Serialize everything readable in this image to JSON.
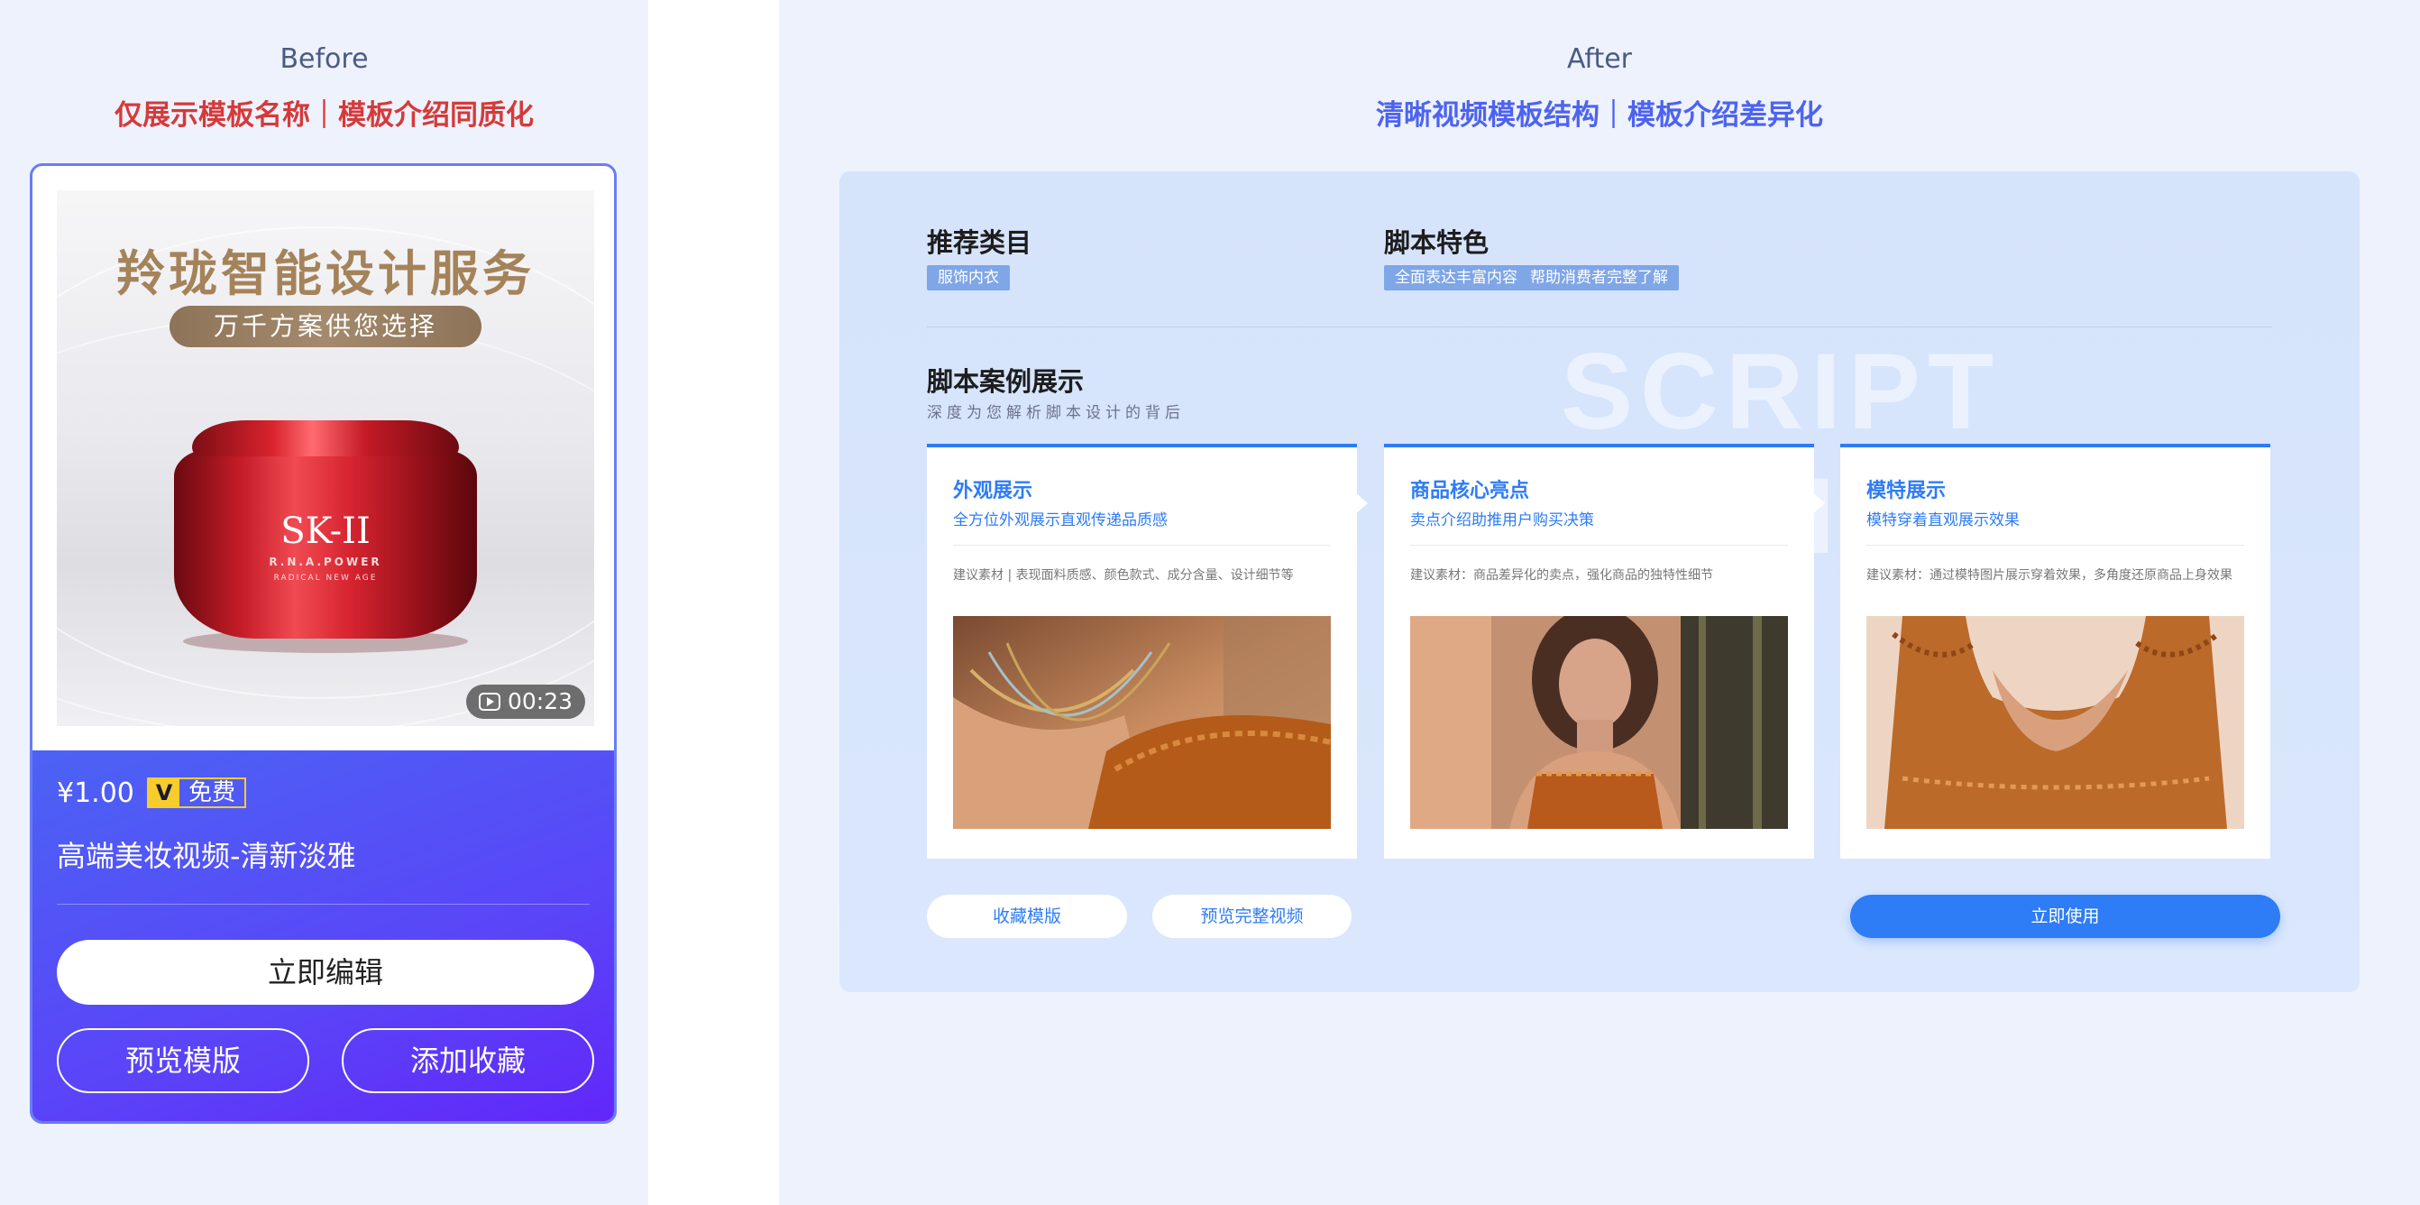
{
  "before": {
    "title": "Before",
    "subtitle": "仅展示模板名称｜模板介绍同质化",
    "card": {
      "thumbnail": {
        "heading": "羚珑智能设计服务",
        "pill": "万千方案供您选择",
        "product_brand": "SK-II",
        "product_line": "R.N.A.POWER",
        "product_sub": "RADICAL NEW AGE",
        "duration": "00:23"
      },
      "price": "¥1.00",
      "vip_letter": "V",
      "vip_label": "免费",
      "template_name": "高端美妆视频-清新淡雅",
      "edit_button": "立即编辑",
      "preview_button": "预览模版",
      "favorite_button": "添加收藏"
    }
  },
  "after": {
    "title": "After",
    "subtitle": "清晰视频模板结构｜模板介绍差异化",
    "recommended": {
      "title": "推荐类目",
      "tags": [
        "服饰内衣"
      ]
    },
    "features": {
      "title": "脚本特色",
      "tags": [
        "全面表达丰富内容",
        "帮助消费者完整了解"
      ]
    },
    "cases": {
      "title": "脚本案例展示",
      "subtitle": "深度为您解析脚本设计的背后",
      "watermark": "SCRIPT DESIGN",
      "items": [
        {
          "title": "外观展示",
          "subtitle": "全方位外观展示直观传递品质感",
          "desc": "建议素材 | 表现面料质感、颜色款式、成分含量、设计细节等"
        },
        {
          "title": "商品核心亮点",
          "subtitle": "卖点介绍助推用户购买决策",
          "desc": "建议素材：商品差异化的卖点，强化商品的独特性细节"
        },
        {
          "title": "模特展示",
          "subtitle": "模特穿着直观展示效果",
          "desc": "建议素材：通过模特图片展示穿着效果，多角度还原商品上身效果"
        }
      ]
    },
    "buttons": {
      "favorite": "收藏模版",
      "preview": "预览完整视频",
      "use": "立即使用"
    }
  },
  "colors": {
    "accent_blue": "#2e7cf6",
    "before_red": "#d53a3a",
    "after_blue": "#4d63f0",
    "vip_yellow": "#f6cd2c"
  }
}
